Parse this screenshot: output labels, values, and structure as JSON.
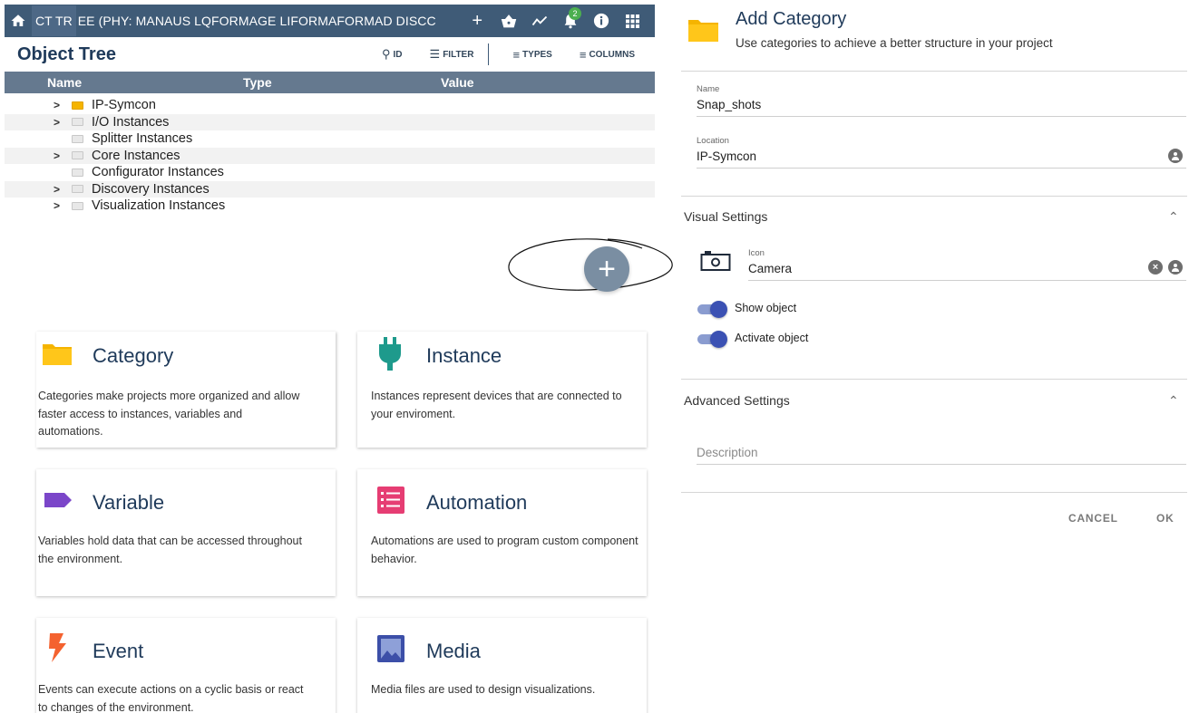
{
  "topbar": {
    "tab_text": "CT TR",
    "tab_text_rest": "EE (PHY: MANAUS LQFORMAGE LIFORMAFORMAD DISCC",
    "plus": "+",
    "notification_count": "2"
  },
  "tree": {
    "title": "Object Tree",
    "tools": {
      "id": "ID",
      "filter": "FILTER",
      "types": "TYPES",
      "columns": "COLUMNS"
    },
    "columns": {
      "name": "Name",
      "type": "Type",
      "value": "Value"
    },
    "rows": [
      {
        "label": "IP-Symcon",
        "expandable": true,
        "gold": true
      },
      {
        "label": "I/O Instances",
        "expandable": true,
        "gold": false
      },
      {
        "label": "Splitter Instances",
        "expandable": false,
        "gold": false
      },
      {
        "label": "Core Instances",
        "expandable": true,
        "gold": false
      },
      {
        "label": "Configurator Instances",
        "expandable": false,
        "gold": false
      },
      {
        "label": "Discovery Instances",
        "expandable": true,
        "gold": false
      },
      {
        "label": "Visualization Instances",
        "expandable": true,
        "gold": false
      }
    ],
    "fab_label": "+"
  },
  "cards": {
    "category": {
      "title": "Category",
      "desc": "Categories make projects more organized and allow faster access to instances, variables and automations."
    },
    "instance": {
      "title": "Instance",
      "desc": "Instances represent devices that are connected to your enviroment."
    },
    "variable": {
      "title": "Variable",
      "desc": "Variables hold data that can be accessed throughout the environment."
    },
    "automation": {
      "title": "Automation",
      "desc": "Automations are used to program custom component behavior."
    },
    "event": {
      "title": "Event",
      "desc": "Events can execute actions on a cyclic basis or react to changes of the environment."
    },
    "media": {
      "title": "Media",
      "desc": "Media files are used to design visualizations."
    }
  },
  "dialog": {
    "title": "Add Category",
    "subtitle": "Use categories to achieve a better structure in your project",
    "name_label": "Name",
    "name_value": "Snap_shots",
    "location_label": "Location",
    "location_value": "IP-Symcon",
    "visual_settings": "Visual Settings",
    "icon_label": "Icon",
    "icon_value": "Camera",
    "show_object": "Show object",
    "activate_object": "Activate object",
    "advanced_settings": "Advanced Settings",
    "description_placeholder": "Description",
    "cancel": "CANCEL",
    "ok": "OK"
  },
  "colors": {
    "topbar": "#3f5b77",
    "title": "#1f3a5a",
    "toggle": "#3b51b3",
    "folder": "#f5b400"
  }
}
